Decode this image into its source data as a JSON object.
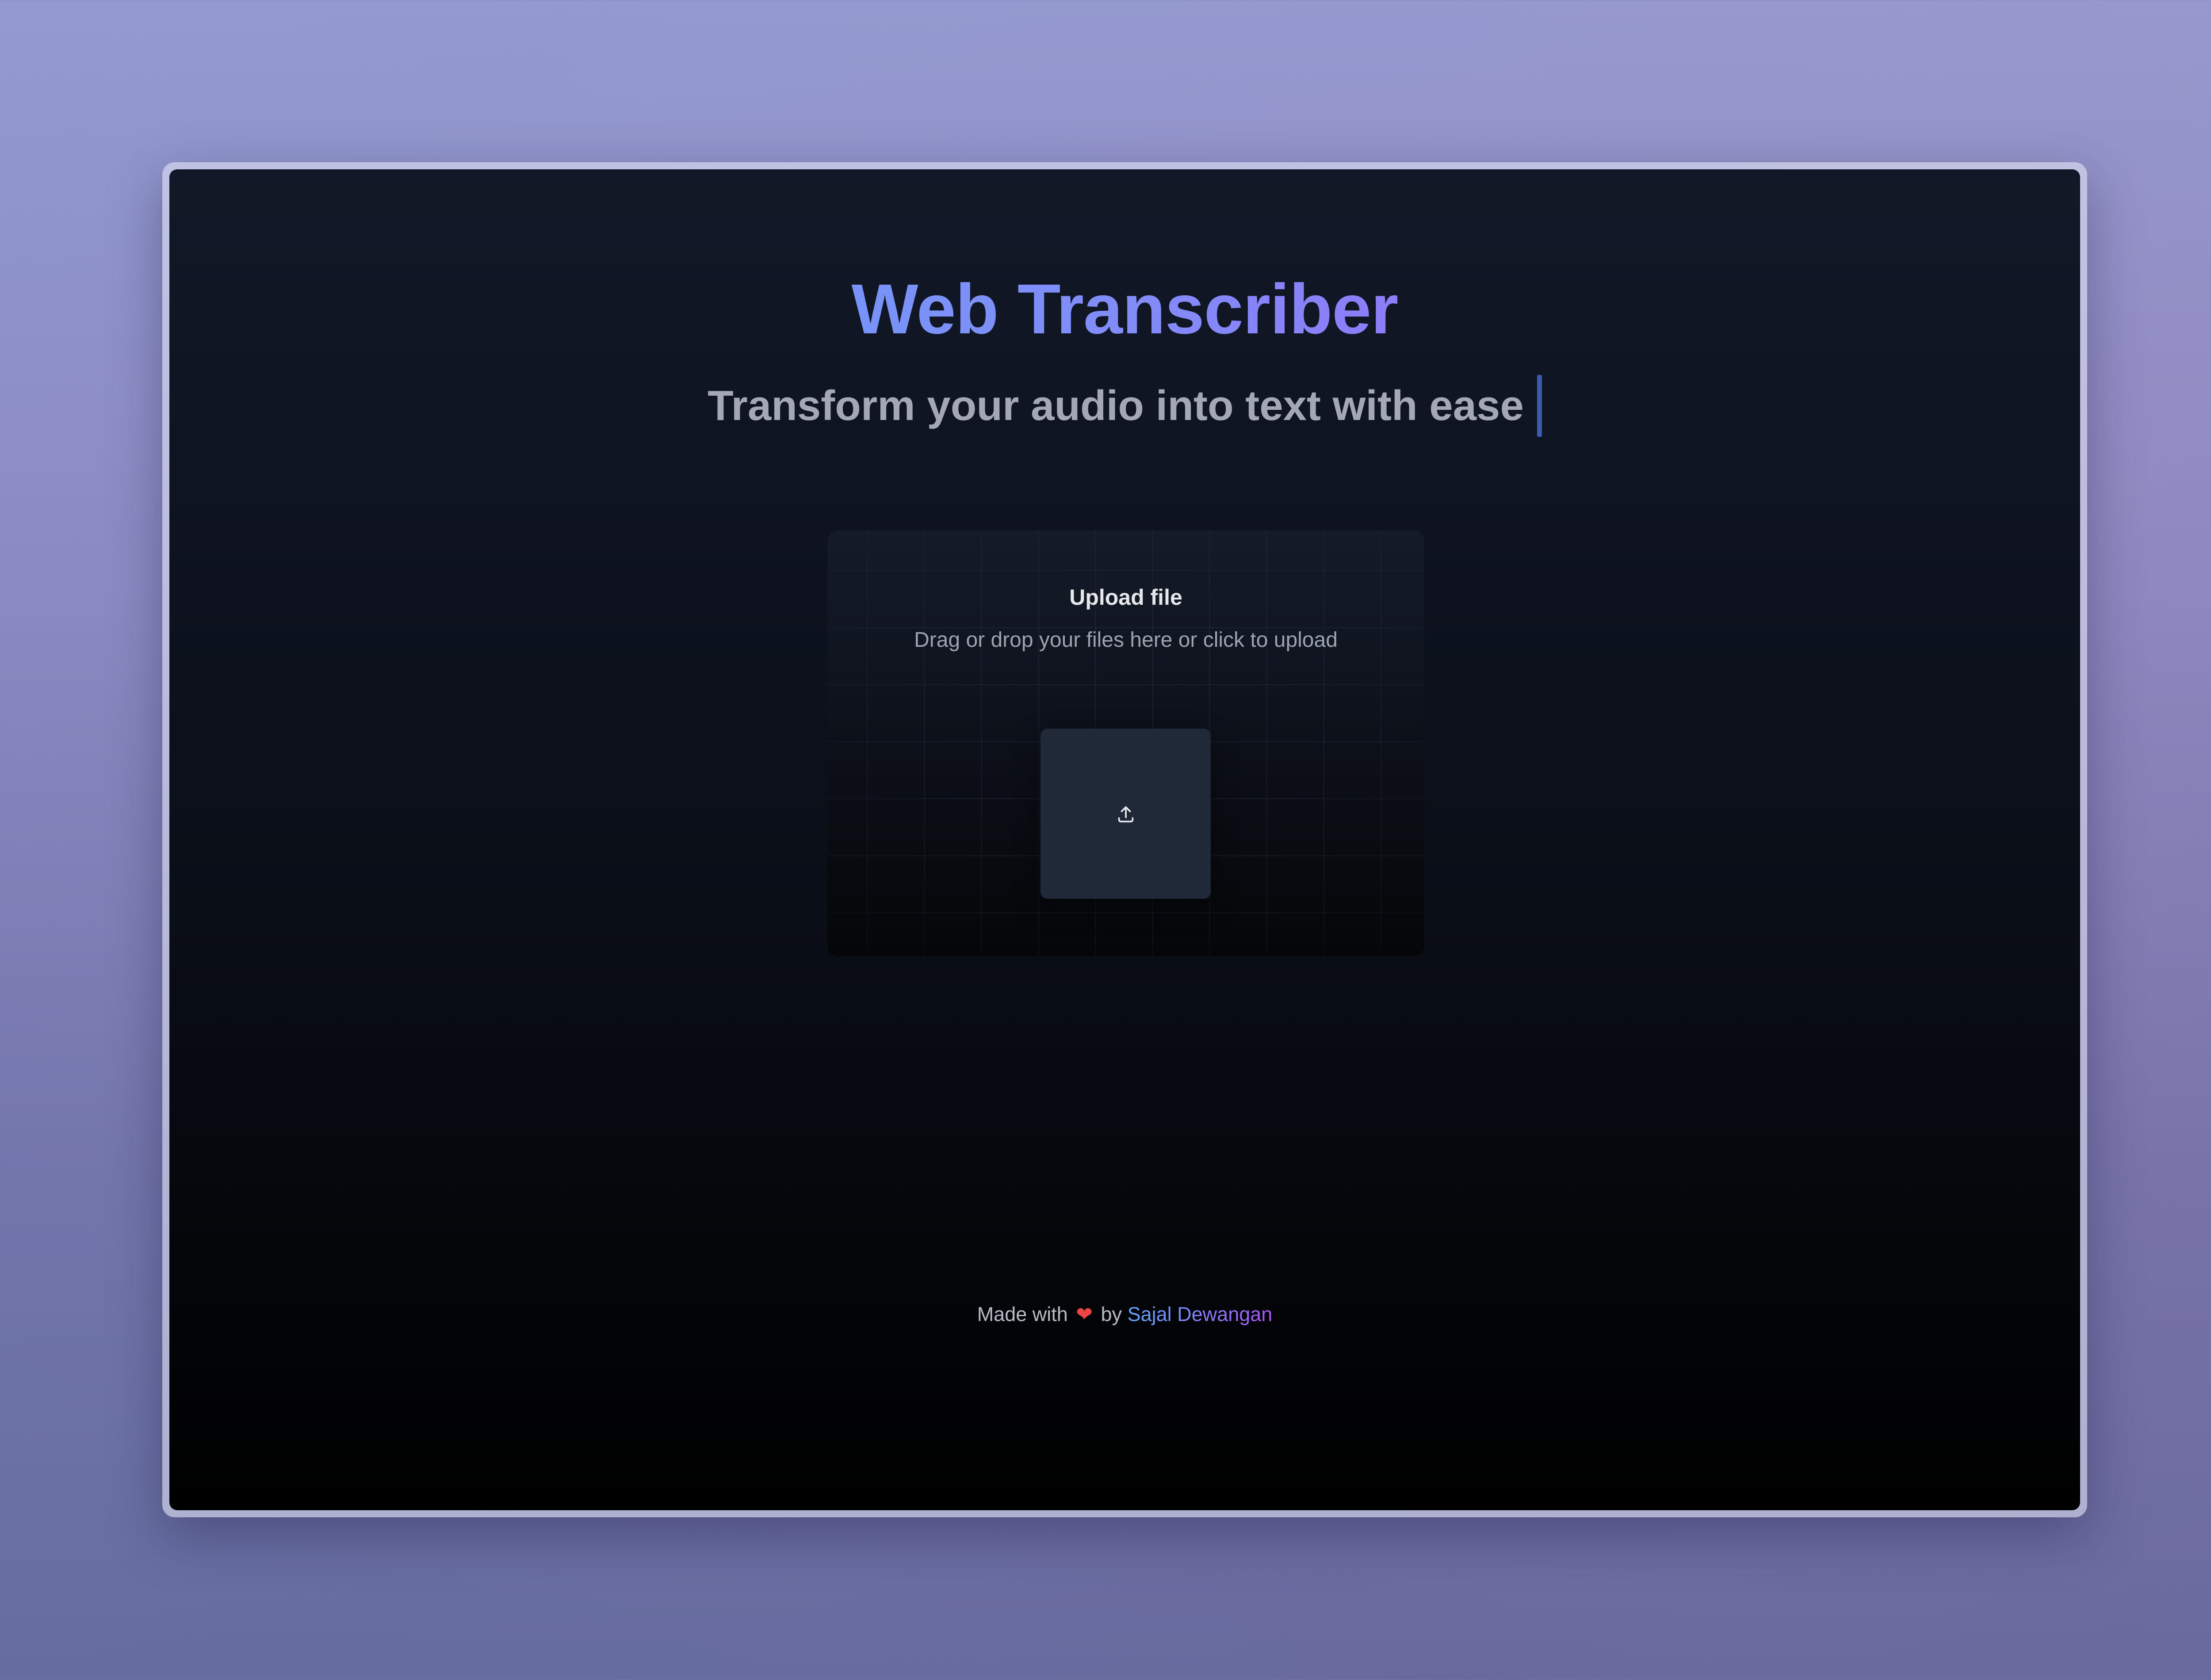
{
  "app": {
    "title": "Web Transcriber",
    "subtitle": "Transform your audio into text with ease"
  },
  "upload": {
    "heading": "Upload file",
    "description": "Drag or drop your files here or click to upload",
    "icon": "upload-icon"
  },
  "footer": {
    "prefix": "Made with",
    "heart": "❤",
    "by": "by",
    "author": "Sajal Dewangan"
  },
  "colors": {
    "title_gradient_start": "#60a5fa",
    "title_gradient_end": "#a855f7",
    "cursor": "#3b5bb0",
    "upload_box": "#1f2937",
    "heart": "#ef4444"
  }
}
